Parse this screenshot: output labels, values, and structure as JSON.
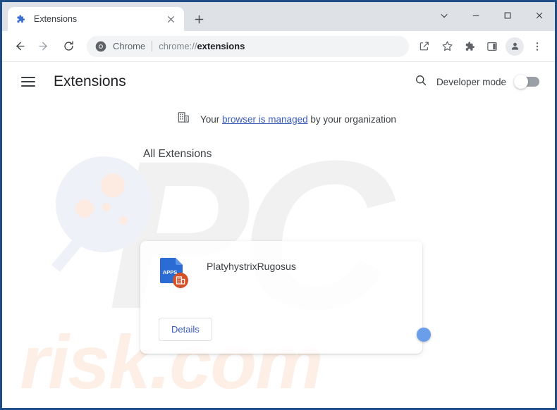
{
  "window": {
    "controls": [
      {
        "name": "tab-search",
        "icon": "chevron-down-icon"
      },
      {
        "name": "minimize",
        "icon": "minimize-icon"
      },
      {
        "name": "maximize",
        "icon": "maximize-icon"
      },
      {
        "name": "close",
        "icon": "close-icon"
      }
    ]
  },
  "tabstrip": {
    "tab": {
      "title": "Extensions",
      "favicon": "puzzle-piece-icon",
      "close_label": "✕"
    },
    "new_tab_label": "+"
  },
  "toolbar": {
    "back_label": "←",
    "forward_label": "→",
    "reload_label": "⟳",
    "omnibox": {
      "site_label": "Chrome",
      "url_prefix": "chrome://",
      "url_emphasis": "extensions",
      "full_url": "chrome://extensions"
    },
    "actions": [
      {
        "name": "share-icon"
      },
      {
        "name": "bookmark-star-icon"
      },
      {
        "name": "extensions-puzzle-icon"
      },
      {
        "name": "side-panel-icon"
      },
      {
        "name": "profile-avatar"
      },
      {
        "name": "three-dot-menu-icon"
      }
    ]
  },
  "page": {
    "title": "Extensions",
    "menu_icon": "hamburger-icon",
    "search_icon": "search-icon",
    "developer_mode": {
      "label": "Developer mode",
      "enabled": false
    },
    "managed_banner": {
      "icon": "organization-building-icon",
      "text_before": "Your ",
      "link_text": "browser is managed",
      "text_after": " by your organization"
    },
    "section_heading": "All Extensions",
    "extensions": [
      {
        "name": "PlatyhystrixRugosus",
        "icon_label": "APPS",
        "badge_icon": "organization-building-icon",
        "details_label": "Details",
        "enabled": true
      }
    ]
  },
  "watermarks": {
    "letters": "PC",
    "domain": "risk.com"
  },
  "colors": {
    "frame_border": "#1f4e86",
    "tabstrip_bg": "#dee1e6",
    "accent_blue": "#3a5bbc",
    "link_blue": "#3a5bbc",
    "toggle_on": "#aac7f5",
    "toggle_off": "#9aa0a6",
    "ext_icon_blue": "#2b6cd4",
    "ext_badge_orange": "#d4522a",
    "watermark_grey": "#f1f1f1",
    "watermark_peach": "#fdefe6"
  }
}
